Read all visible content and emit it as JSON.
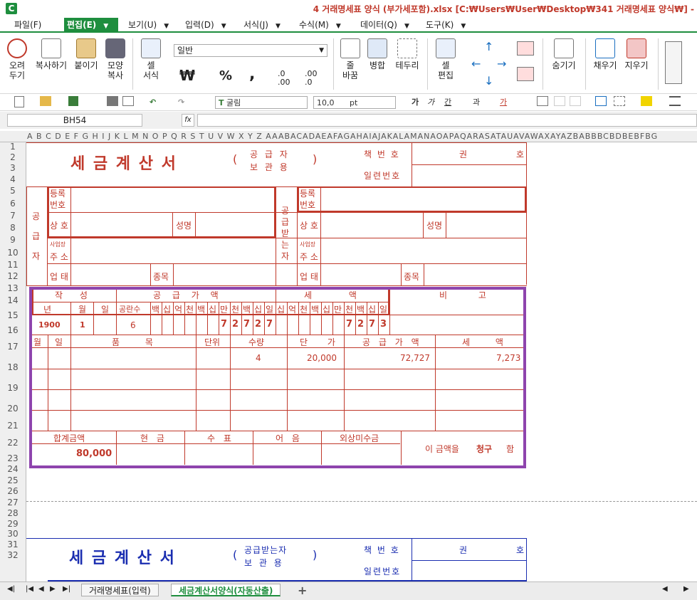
{
  "window": {
    "title": "4 거래명세표 양식 (부가세포함).xlsx [C:₩Users₩User₩Desktop₩341 거래명세표 양식₩] -",
    "logo": "C"
  },
  "menu": [
    "파일(F)",
    "편집(E)",
    "보기(U)",
    "입력(D)",
    "서식(J)",
    "수식(M)",
    "데이터(Q)",
    "도구(K)"
  ],
  "ribbon": {
    "cut": "오려\n두기",
    "copy": "복사하기",
    "paste": "붙이기",
    "format_copy": "모양\n복사",
    "cell_format": "셀\n서식",
    "number_format": "일반",
    "currency": "₩",
    "percent": "%",
    "comma": ",",
    "dec_increase": ".0 .00",
    "dec_decrease": ".00 .0",
    "wrap": "줄\n바꿈",
    "merge": "병합",
    "border": "테두리",
    "cell_edit": "셀\n편집",
    "hide": "숨기기",
    "fill": "채우기",
    "clear": "지우기"
  },
  "fmtbar": {
    "font": "굴림",
    "size": "10,0",
    "unit": "pt",
    "ga1": "가",
    "ga2": "가",
    "ga3": "간",
    "ga4": "과",
    "ga5": "가"
  },
  "namebox": "BH54",
  "fx": "fx",
  "columns": "A B C D E F G H I J K L M N O P Q R S T U V W X Y Z AAABACADAEAFAGAHAIAJAKALAMANAOAPAQARASATAUAVAWAXAYAZBABBBCBDBEBFBG",
  "rows": [
    "1",
    "2",
    "3",
    "4",
    "5",
    "6",
    "7",
    "8",
    "9",
    "10",
    "11",
    "12",
    "13",
    "14",
    "15",
    "16",
    "17",
    "18",
    "19",
    "20",
    "21",
    "22",
    "23",
    "24",
    "25",
    "26",
    "27",
    "28",
    "29",
    "30",
    "31",
    "32"
  ],
  "invoice1": {
    "title": "세 금 계 산 서",
    "copy_paren_open": "(",
    "copy_line1": "공 급 자",
    "copy_line2": "보 관 용",
    "copy_paren_close": ")",
    "book_no": "책 번 호",
    "serial_no": "일련번호",
    "gwon": "권",
    "ho": "호",
    "supplier": "공\n급\n자",
    "receiver": "공\n급\n받\n는\n자",
    "reg_no": "등록\n번호",
    "company": "상 호",
    "name": "성명",
    "addr_small": "사업장",
    "addr": "주 소",
    "biz_type": "업 태",
    "biz_item": "종목",
    "written": "작 성",
    "supply_amount": "공 급 가 액",
    "tax": "세 액",
    "note": "비 고",
    "year": "년",
    "month": "월",
    "day": "일",
    "blank_count": "공란수",
    "digits_supply": [
      "백",
      "십",
      "억",
      "천",
      "백",
      "십",
      "만",
      "천",
      "백",
      "십",
      "일"
    ],
    "digits_tax": [
      "십",
      "억",
      "천",
      "백",
      "십",
      "만",
      "천",
      "백",
      "십",
      "일"
    ],
    "year_val": "1900",
    "month_val": "1",
    "blank_val": "6",
    "supply_digits_val": [
      "7",
      "2",
      "7",
      "2",
      "7"
    ],
    "tax_digits_val": [
      "7",
      "2",
      "7",
      "3"
    ],
    "item_header": {
      "month": "월",
      "day": "일",
      "item": "품 목",
      "unit": "단위",
      "qty": "수량",
      "price": "단 가",
      "supply": "공 급 가 액",
      "tax": "세 액"
    },
    "row17": {
      "qty": "4",
      "price": "20,000",
      "supply": "72,727",
      "tax": "7,273"
    },
    "total_label": "합계금액",
    "cash": "현 금",
    "check": "수 표",
    "bill": "어 음",
    "credit": "외상미수금",
    "total_val": "80,000",
    "claim_prefix": "이 금액을",
    "claim_word": "청구",
    "claim_suffix": "함"
  },
  "invoice2": {
    "title": "세 금 계 산 서",
    "copy_paren_open": "(",
    "copy_line1": "공급받는자",
    "copy_line2": "보 관 용",
    "copy_paren_close": ")",
    "book_no": "책 번 호",
    "serial_no": "일련번호",
    "gwon": "권",
    "ho": "호"
  },
  "sheets": [
    "거래명세표(입력)",
    "세금계산서양식(자동산출)"
  ],
  "colors": {
    "accent": "#1e8e3e",
    "red": "#c0392b",
    "blue": "#1a2db0",
    "purple": "#8e44ad"
  }
}
